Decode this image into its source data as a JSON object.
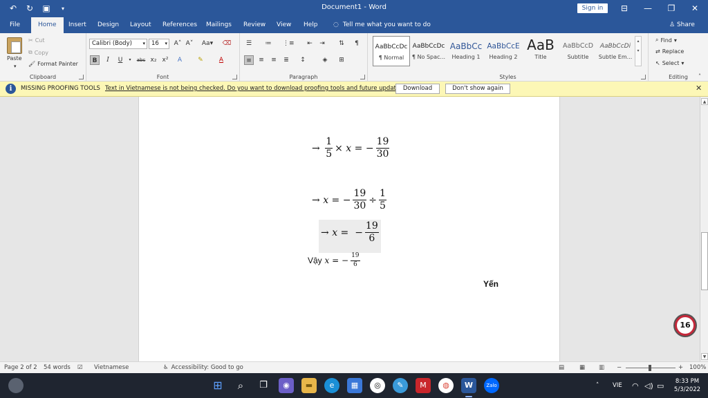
{
  "titlebar": {
    "document_title": "Document1",
    "separator": "-",
    "app_name": "Word",
    "sign_in_label": "Sign in",
    "qat_icons": [
      "undo-icon",
      "redo-icon",
      "save-icon",
      "customize-icon"
    ]
  },
  "menu": {
    "tabs": [
      "File",
      "Home",
      "Insert",
      "Design",
      "Layout",
      "References",
      "Mailings",
      "Review",
      "View",
      "Help"
    ],
    "active_tab": "Home",
    "tell_me": "Tell me what you want to do",
    "share": "Share"
  },
  "ribbon": {
    "clipboard": {
      "label": "Clipboard",
      "paste": "Paste",
      "cut": "Cut",
      "copy": "Copy",
      "format_painter": "Format Painter"
    },
    "font": {
      "label": "Font",
      "font_name": "Calibri (Body)",
      "font_size": "16"
    },
    "paragraph": {
      "label": "Paragraph"
    },
    "styles": {
      "label": "Styles",
      "items": [
        {
          "preview": "AaBbCcDc",
          "name": "¶ Normal"
        },
        {
          "preview": "AaBbCcDc",
          "name": "¶ No Spac..."
        },
        {
          "preview": "AaBbCc",
          "name": "Heading 1"
        },
        {
          "preview": "AaBbCcE",
          "name": "Heading 2"
        },
        {
          "preview": "AaB",
          "name": "Title"
        },
        {
          "preview": "AaBbCcD",
          "name": "Subtitle"
        },
        {
          "preview": "AaBbCcDi",
          "name": "Subtle Em..."
        }
      ]
    },
    "editing": {
      "label": "Editing",
      "find": "Find",
      "replace": "Replace",
      "select": "Select"
    }
  },
  "infobar": {
    "title": "MISSING PROOFING TOOLS",
    "message": "Text in Vietnamese is not being checked. Do you want to download proofing tools and future updates?",
    "download": "Download",
    "dont_show": "Don't show again"
  },
  "document": {
    "arrow": "→",
    "eq1": {
      "num": "1",
      "den": "5",
      "times": "×",
      "var": "x",
      "eq": "=",
      "neg": "−",
      "rnum": "19",
      "rden": "30"
    },
    "eq2": {
      "var": "x",
      "eq": "=",
      "neg": "−",
      "num": "19",
      "den": "30",
      "div": "÷",
      "rnum": "1",
      "rden": "5"
    },
    "eq3": {
      "var": "x",
      "eq": "=",
      "neg": "−",
      "num": "19",
      "den": "6"
    },
    "conclusion": {
      "prefix": "Vậy",
      "var": "x",
      "eq": "=",
      "neg": "−",
      "num": "19",
      "den": "6"
    },
    "signature": "Yến"
  },
  "notification_badge": "16",
  "statusbar": {
    "page": "Page 2 of 2",
    "words": "54 words",
    "language": "Vietnamese",
    "accessibility": "Accessibility: Good to go",
    "zoom": "100%",
    "zoom_minus": "−",
    "zoom_plus": "+"
  },
  "taskbar": {
    "language": "VIE",
    "time": "8:33 PM",
    "date": "5/3/2022"
  },
  "colors": {
    "word_blue": "#2b579a",
    "infobar_yellow": "#fcf7b6",
    "taskbar": "#1f2530"
  }
}
